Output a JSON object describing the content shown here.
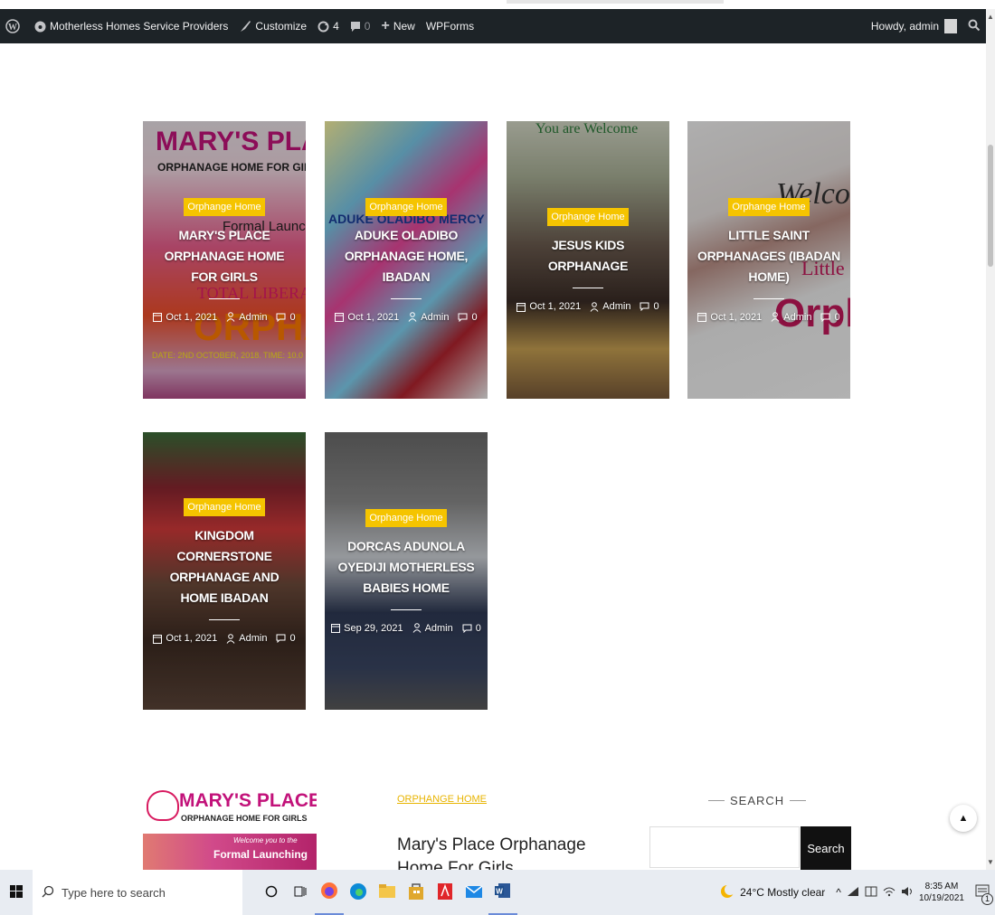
{
  "admin_bar": {
    "site_name": "Motherless Homes Service Providers",
    "customize": "Customize",
    "updates_count": "4",
    "comments_count": "0",
    "new_label": "New",
    "wpforms": "WPForms",
    "greeting": "Howdy, admin"
  },
  "cards": [
    {
      "category": "Orphange Home",
      "title": "MARY'S PLACE ORPHANAGE HOME FOR GIRLS",
      "date": "Oct 1, 2021",
      "author": "Admin",
      "comments": "0",
      "bg_image_text": [
        "MARY'S PLAC",
        "ORPHANAGE HOME FOR GIR",
        "Formal Launching",
        "TOTAL LIBERATION",
        "ORPHAN",
        "DATE: 2ND OCTOBER, 2018. TIME: 10.0"
      ]
    },
    {
      "category": "Orphange Home",
      "title": "ADUKE OLADIBO ORPHANAGE HOME, IBADAN",
      "date": "Oct 1, 2021",
      "author": "Admin",
      "comments": "0",
      "bg_image_text": [
        "ADUKE OLADIBO MERCY"
      ]
    },
    {
      "category": "Orphange Home",
      "title": "JESUS KIDS ORPHANAGE",
      "date": "Oct 1, 2021",
      "author": "Admin",
      "comments": "0",
      "bg_image_text": [
        "You are Welcome"
      ]
    },
    {
      "category": "Orphange Home",
      "title": "LITTLE SAINT ORPHANAGES (IBADAN HOME)",
      "date": "Oct 1, 2021",
      "author": "Admin",
      "comments": "0",
      "bg_image_text": [
        "Welcom",
        "Little",
        "Orph"
      ]
    },
    {
      "category": "Orphange Home",
      "title": "KINGDOM CORNERSTONE ORPHANAGE AND HOME IBADAN",
      "date": "Oct 1, 2021",
      "author": "Admin",
      "comments": "0",
      "bg_image_text": []
    },
    {
      "category": "Orphange Home",
      "title": "DORCAS ADUNOLA OYEDIJI MOTHERLESS BABIES HOME",
      "date": "Sep 29, 2021",
      "author": "Admin",
      "comments": "0",
      "bg_image_text": []
    }
  ],
  "footer": {
    "logo": {
      "title": "MARY'S PLACE",
      "subtitle": "ORPHANAGE HOME FOR GIRLS",
      "welcome": "Welcome you to the",
      "launching": "Formal Launching"
    },
    "post_category": "ORPHANGE HOME",
    "post_title": "Mary's Place Orphanage Home For Girls",
    "search_heading": "SEARCH",
    "search_button": "Search",
    "search_value": ""
  },
  "taskbar": {
    "search_placeholder": "Type here to search",
    "weather": "24°C  Mostly clear",
    "time": "8:35 AM",
    "date": "10/19/2021",
    "notification_count": "1"
  },
  "colors": {
    "admin_bar": "#1d2327",
    "badge": "#f5c400",
    "taskbar": "#e8ecf2"
  }
}
